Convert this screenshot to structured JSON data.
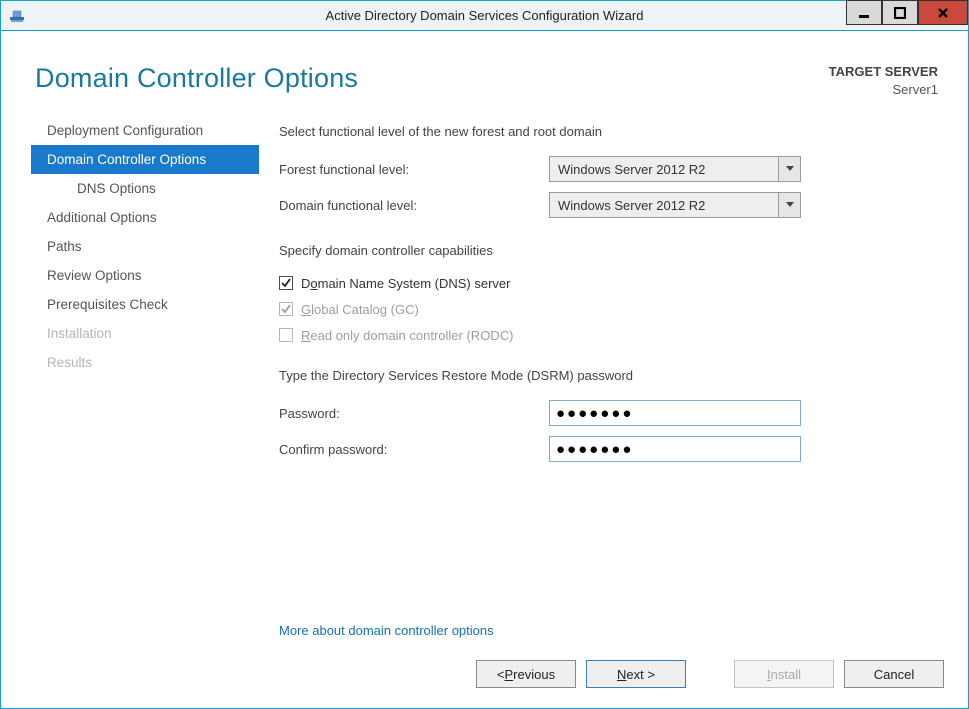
{
  "window": {
    "title": "Active Directory Domain Services Configuration Wizard"
  },
  "header": {
    "page_title": "Domain Controller Options",
    "target_label": "TARGET SERVER",
    "target_value": "Server1"
  },
  "sidebar": {
    "items": [
      {
        "label": "Deployment Configuration"
      },
      {
        "label": "Domain Controller Options"
      },
      {
        "label": "DNS Options"
      },
      {
        "label": "Additional Options"
      },
      {
        "label": "Paths"
      },
      {
        "label": "Review Options"
      },
      {
        "label": "Prerequisites Check"
      },
      {
        "label": "Installation"
      },
      {
        "label": "Results"
      }
    ]
  },
  "content": {
    "functional_heading": "Select functional level of the new forest and root domain",
    "forest_label": "Forest functional level:",
    "forest_value": "Windows Server 2012 R2",
    "domain_label": "Domain functional level:",
    "domain_value": "Windows Server 2012 R2",
    "caps_heading": "Specify domain controller capabilities",
    "dns_pre": "D",
    "dns_ul": "o",
    "dns_post": "main Name System (DNS) server",
    "gc_ul": "G",
    "gc_post": "lobal Catalog (GC)",
    "rodc_ul": "R",
    "rodc_post": "ead only domain controller (RODC)",
    "dsrm_heading": "Type the Directory Services Restore Mode (DSRM) password",
    "pwd_label_pre": "Passwor",
    "pwd_label_ul": "d",
    "pwd_label_post": ":",
    "cpwd_label_ul": "C",
    "cpwd_label_post": "onfirm password:",
    "pwd_value": "●●●●●●●",
    "cpwd_value": "●●●●●●●",
    "more_link": "More about domain controller options"
  },
  "footer": {
    "prev_pre": "< ",
    "prev_ul": "P",
    "prev_post": "revious",
    "next_ul": "N",
    "next_post": "ext >",
    "install_ul": "I",
    "install_post": "nstall",
    "cancel": "Cancel"
  }
}
